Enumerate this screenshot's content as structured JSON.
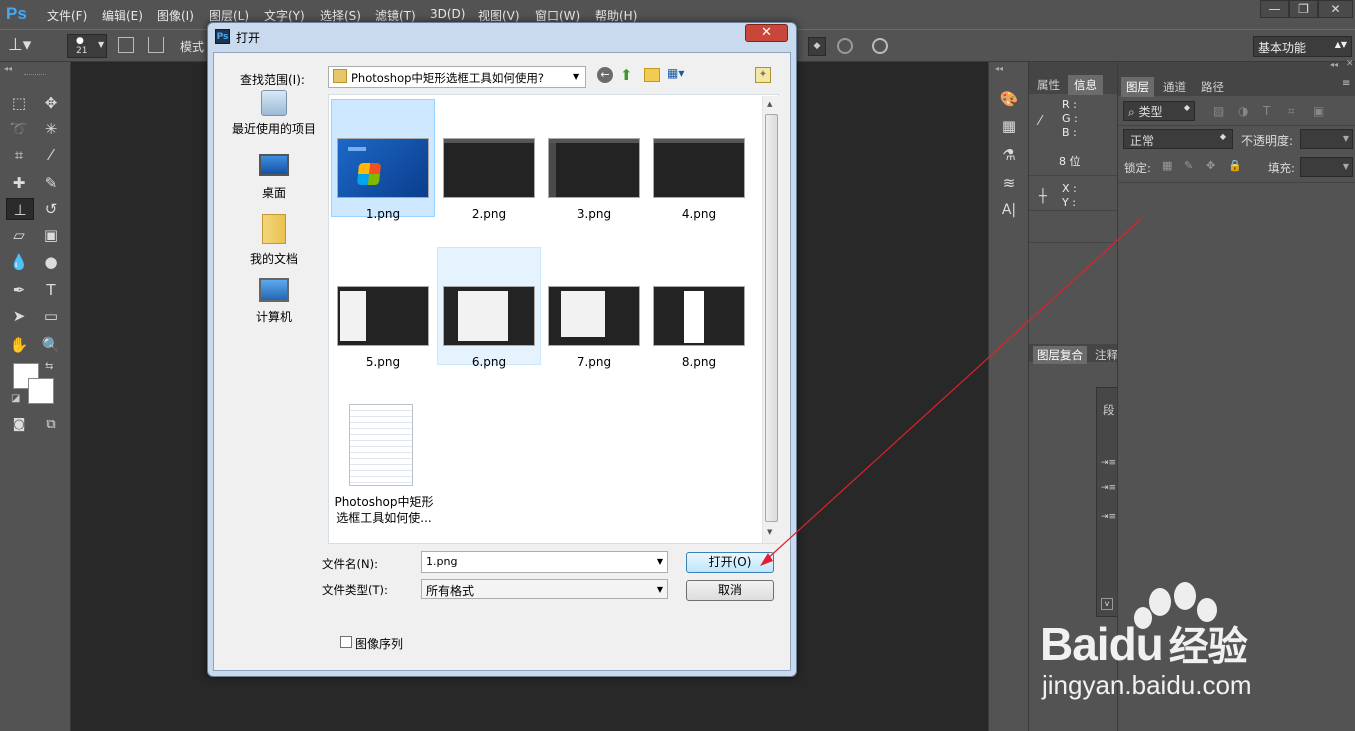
{
  "app": {
    "logo": "Ps"
  },
  "menu": [
    "文件(F)",
    "编辑(E)",
    "图像(I)",
    "图层(L)",
    "文字(Y)",
    "选择(S)",
    "滤镜(T)",
    "3D(D)",
    "视图(V)",
    "窗口(W)",
    "帮助(H)"
  ],
  "window_controls": [
    "—",
    "❐",
    "✕"
  ],
  "options_bar": {
    "brush_size": "21",
    "mode_label": "模式",
    "workspace": "基本功能"
  },
  "panels": {
    "properties_tab": "属性",
    "info_tab": "信息",
    "info_rgb": [
      "R :",
      "G :",
      "B :"
    ],
    "info_bits": "8 位",
    "info_xy": [
      "X :",
      "Y :"
    ],
    "layer_comps_tab": "图层复合",
    "notes_tab": "注释",
    "layers_tab": "图层",
    "channels_tab": "通道",
    "paths_tab": "路径",
    "filter_kind": "类型",
    "blend_mode": "正常",
    "opacity_label": "不透明度:",
    "lock_label": "锁定:",
    "fill_label": "填充:",
    "paragraph_tab": "段"
  },
  "dialog": {
    "title": "打开",
    "look_in_label": "查找范围(I):",
    "look_in_value": "Photoshop中矩形选框工具如何使用?",
    "places": [
      {
        "label": "最近使用的项目",
        "icon": "recent-places-icon"
      },
      {
        "label": "桌面",
        "icon": "desktop-icon"
      },
      {
        "label": "我的文档",
        "icon": "documents-folder-icon"
      },
      {
        "label": "计算机",
        "icon": "computer-icon"
      }
    ],
    "files": [
      {
        "name": "1.png",
        "kind": "win7"
      },
      {
        "name": "2.png",
        "kind": "ps"
      },
      {
        "name": "3.png",
        "kind": "ps"
      },
      {
        "name": "4.png",
        "kind": "ps"
      },
      {
        "name": "5.png",
        "kind": "ps-dialog"
      },
      {
        "name": "6.png",
        "kind": "ps-dialog"
      },
      {
        "name": "7.png",
        "kind": "ps-dialog"
      },
      {
        "name": "8.png",
        "kind": "ps-white"
      }
    ],
    "doc_file_line1": "Photoshop中矩形",
    "doc_file_line2": "选框工具如何使...",
    "filename_label": "文件名(N):",
    "filename_value": "1.png",
    "filetype_label": "文件类型(T):",
    "filetype_value": "所有格式",
    "open_button": "打开(O)",
    "cancel_button": "取消",
    "image_sequence_label": "图像序列"
  },
  "watermark": {
    "brand": "Baidu",
    "suffix": "经验",
    "url": "jingyan.baidu.com"
  },
  "colors": {
    "ps_gray": "#535353",
    "canvas": "#282828",
    "dialog_frame": "#c9d9ee",
    "arrow": "#e0202a"
  }
}
